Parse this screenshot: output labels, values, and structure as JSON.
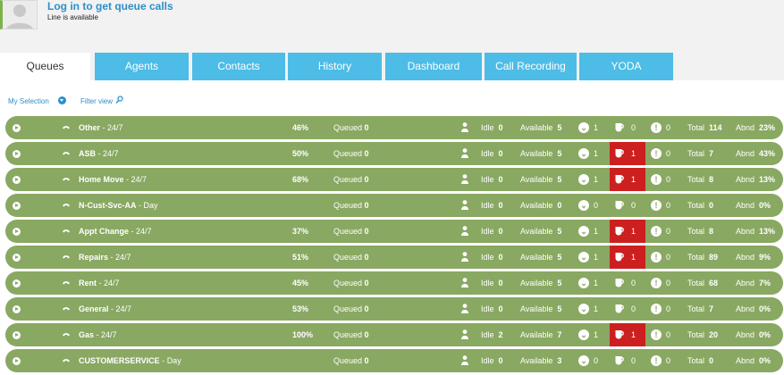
{
  "header": {
    "login_title": "Log in to get queue calls",
    "line_status": "Line is available"
  },
  "tabs": [
    {
      "label": "Queues",
      "active": true
    },
    {
      "label": "Agents",
      "active": false
    },
    {
      "label": "Contacts",
      "active": false
    },
    {
      "label": "History",
      "active": false
    },
    {
      "label": "Dashboard",
      "active": false
    },
    {
      "label": "Call Recording",
      "active": false
    },
    {
      "label": "YODA",
      "active": false
    }
  ],
  "toolbar": {
    "selection_label": "My Selection",
    "filter_label": "Filter view"
  },
  "labels": {
    "queued": "Queued",
    "idle": "Idle",
    "available": "Available",
    "total": "Total",
    "abnd": "Abnd"
  },
  "colors": {
    "row_bg": "#89a862",
    "tab_bg": "#4dbce6",
    "alert_red": "#cc1f1f",
    "link_blue": "#2d8fc8"
  },
  "queues": [
    {
      "name": "Other",
      "schedule": "24/7",
      "percent": "46%",
      "queued": "0",
      "idle": "0",
      "available": "5",
      "checked": "1",
      "on_break": "0",
      "break_alert": false,
      "warnings": "0",
      "total": "114",
      "abnd": "23%",
      "phone_icon": "phone-icon"
    },
    {
      "name": "ASB",
      "schedule": "24/7",
      "percent": "50%",
      "queued": "0",
      "idle": "0",
      "available": "5",
      "checked": "1",
      "on_break": "1",
      "break_alert": true,
      "warnings": "0",
      "total": "7",
      "abnd": "43%",
      "phone_icon": "phone-icon"
    },
    {
      "name": "Home Move",
      "schedule": "24/7",
      "percent": "68%",
      "queued": "0",
      "idle": "0",
      "available": "5",
      "checked": "1",
      "on_break": "1",
      "break_alert": true,
      "warnings": "0",
      "total": "8",
      "abnd": "13%",
      "phone_icon": "phone-icon"
    },
    {
      "name": "N-Cust-Svc-AA",
      "schedule": "Day",
      "percent": "",
      "queued": "0",
      "idle": "0",
      "available": "0",
      "checked": "0",
      "on_break": "0",
      "break_alert": false,
      "warnings": "0",
      "total": "0",
      "abnd": "0%",
      "phone_icon": "phone-icon"
    },
    {
      "name": "Appt Change",
      "schedule": "24/7",
      "percent": "37%",
      "queued": "0",
      "idle": "0",
      "available": "5",
      "checked": "1",
      "on_break": "1",
      "break_alert": true,
      "warnings": "0",
      "total": "8",
      "abnd": "13%",
      "phone_icon": "phone-icon"
    },
    {
      "name": "Repairs",
      "schedule": "24/7",
      "percent": "51%",
      "queued": "0",
      "idle": "0",
      "available": "5",
      "checked": "1",
      "on_break": "1",
      "break_alert": true,
      "warnings": "0",
      "total": "89",
      "abnd": "9%",
      "phone_icon": "phone-icon"
    },
    {
      "name": "Rent",
      "schedule": "24/7",
      "percent": "45%",
      "queued": "0",
      "idle": "0",
      "available": "5",
      "checked": "1",
      "on_break": "0",
      "break_alert": false,
      "warnings": "0",
      "total": "68",
      "abnd": "7%",
      "phone_icon": "phone-icon"
    },
    {
      "name": "General",
      "schedule": "24/7",
      "percent": "53%",
      "queued": "0",
      "idle": "0",
      "available": "5",
      "checked": "1",
      "on_break": "0",
      "break_alert": false,
      "warnings": "0",
      "total": "7",
      "abnd": "0%",
      "phone_icon": "phone-icon"
    },
    {
      "name": "Gas",
      "schedule": "24/7",
      "percent": "100%",
      "queued": "0",
      "idle": "2",
      "available": "7",
      "checked": "1",
      "on_break": "1",
      "break_alert": true,
      "warnings": "0",
      "total": "20",
      "abnd": "0%",
      "phone_icon": "phone-icon"
    },
    {
      "name": "CUSTOMERSERVICE",
      "schedule": "Day",
      "percent": "",
      "queued": "0",
      "idle": "0",
      "available": "3",
      "checked": "0",
      "on_break": "0",
      "break_alert": false,
      "warnings": "0",
      "total": "0",
      "abnd": "0%",
      "phone_icon": "phone-forward-icon"
    }
  ]
}
